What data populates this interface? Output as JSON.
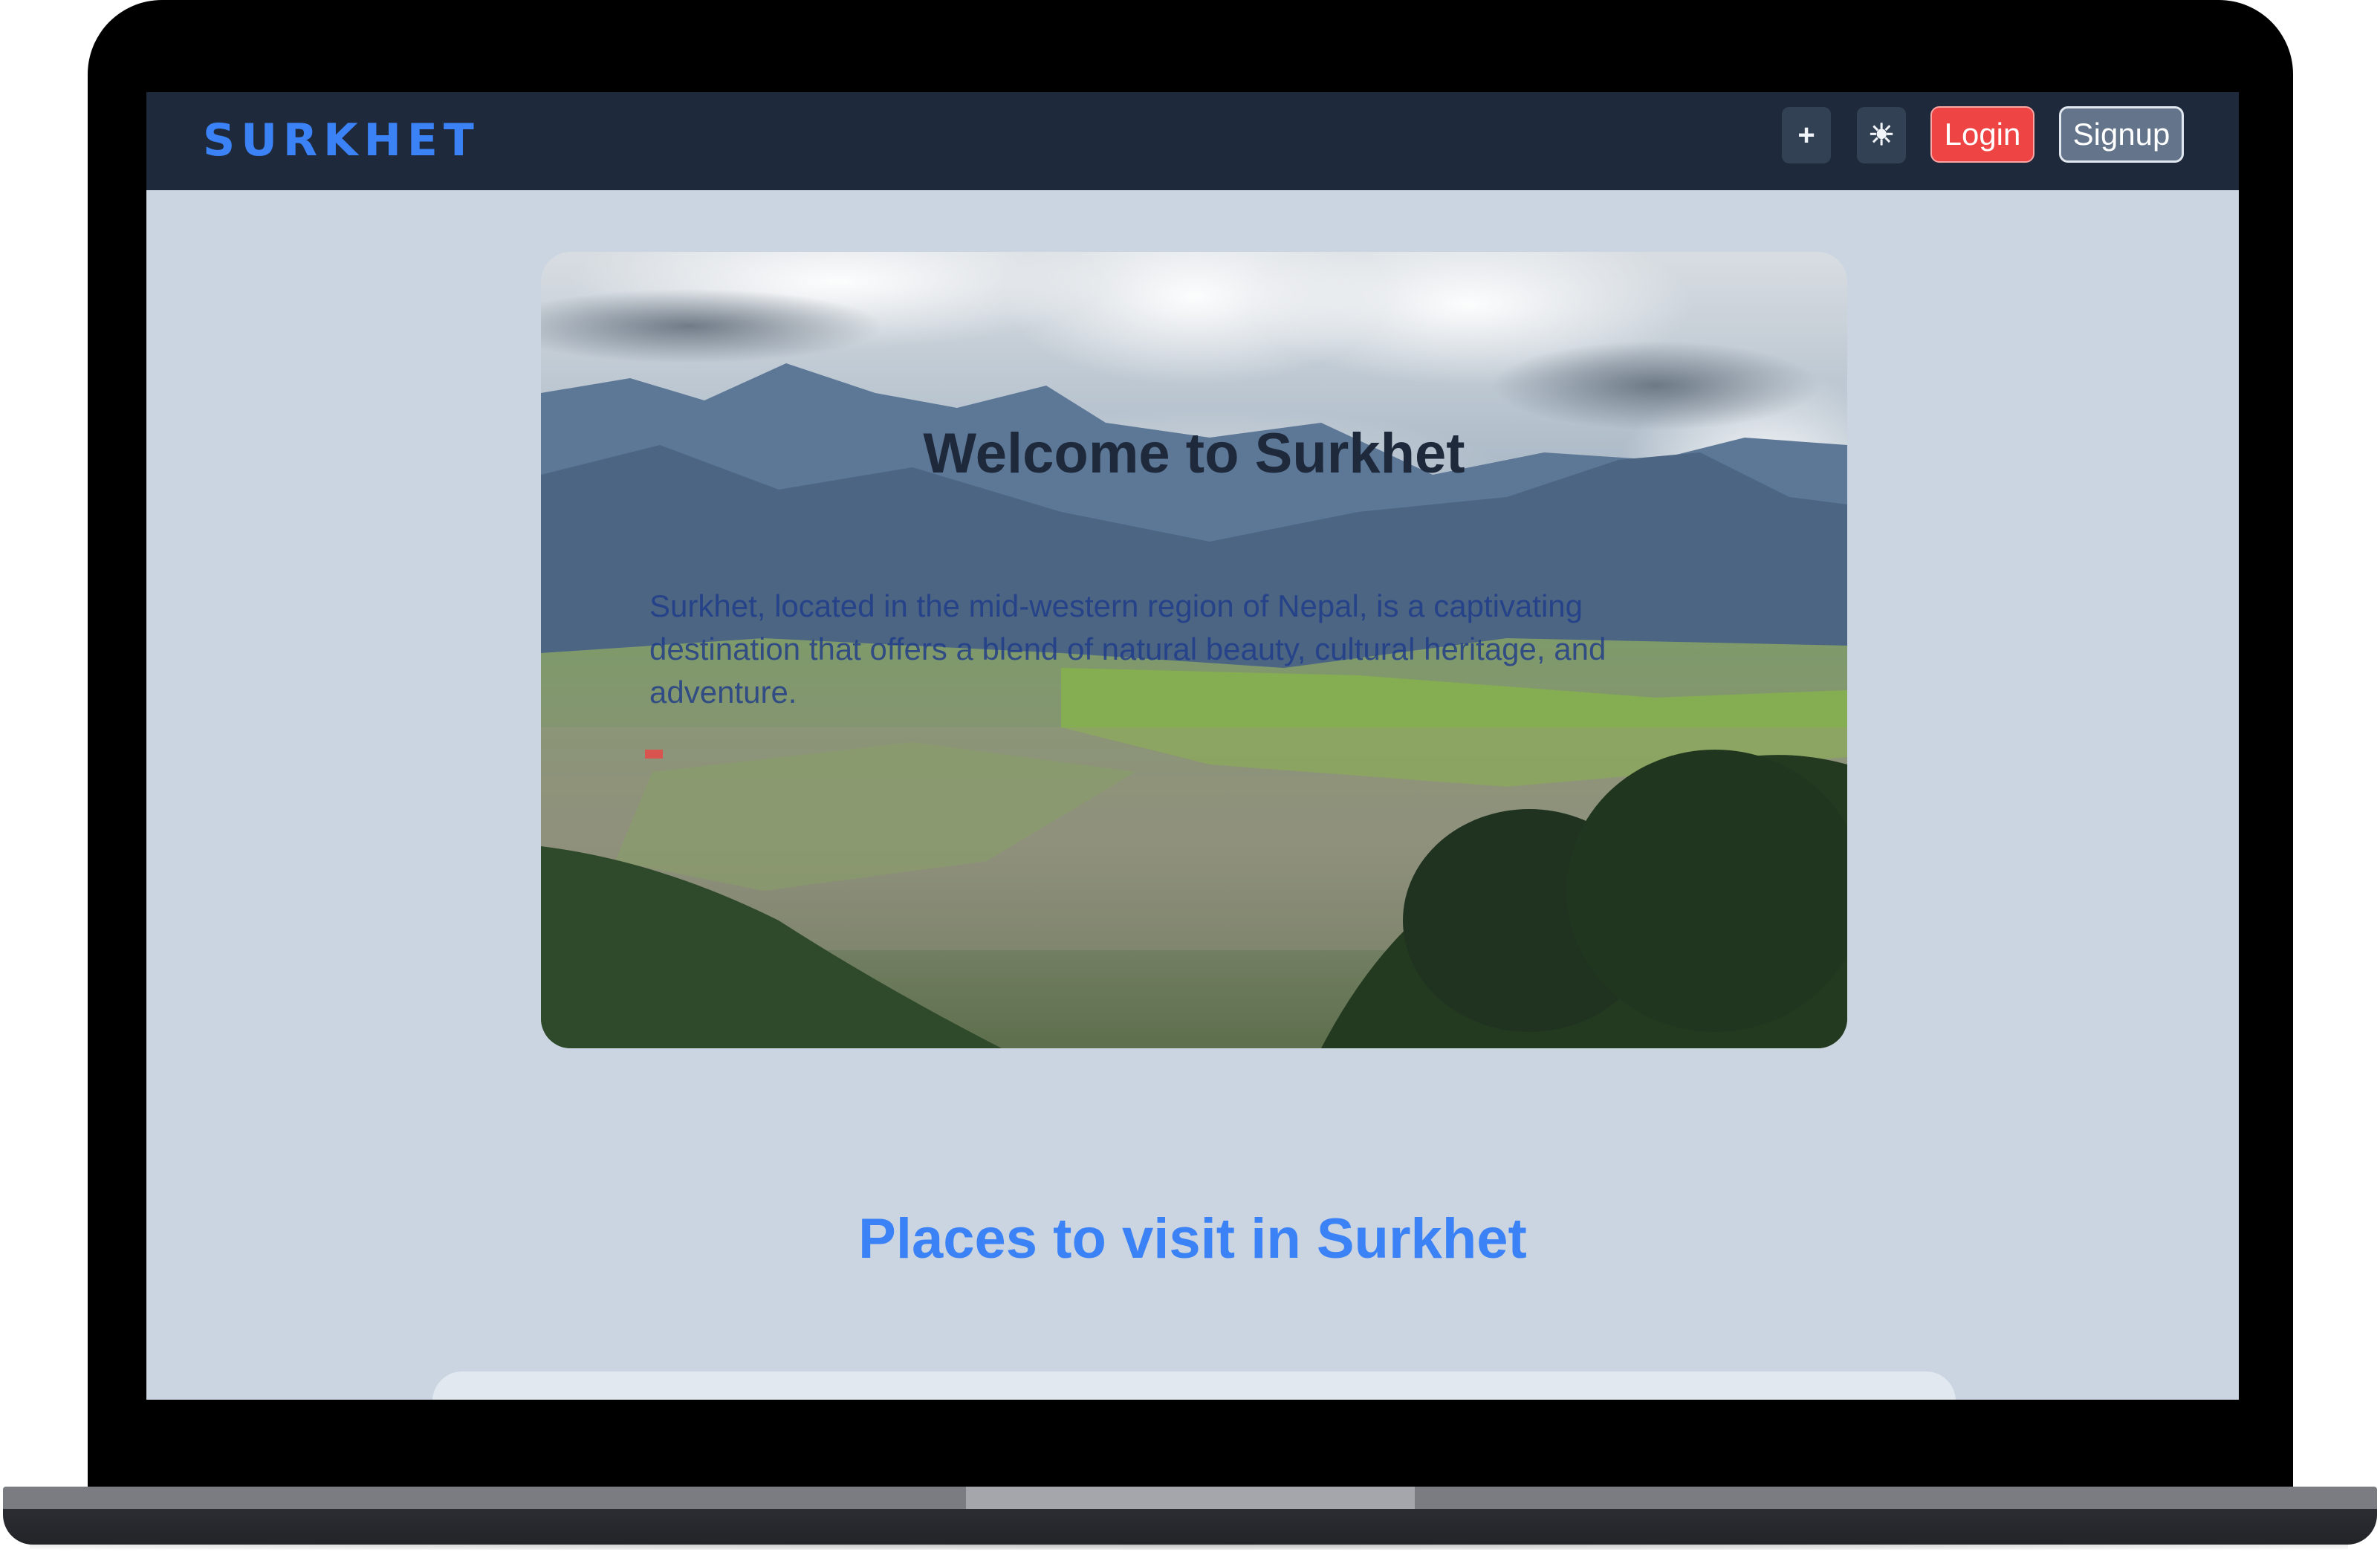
{
  "navbar": {
    "brand": "SURKHET",
    "add_icon": "plus-icon",
    "add_glyph": "+",
    "theme_icon": "sun-icon",
    "theme_glyph": "☀",
    "login_label": "Login",
    "signup_label": "Signup"
  },
  "hero": {
    "title": "Welcome to Surkhet",
    "description": "Surkhet, located in the mid-western region of Nepal, is a captivating destination that offers a blend of natural beauty, cultural heritage, and adventure."
  },
  "places": {
    "title": "Places to visit in Surkhet"
  },
  "colors": {
    "brand": "#3b82f6",
    "navbar_bg": "#1e293b",
    "page_bg": "#cbd5e1",
    "login_bg": "#ef4444",
    "signup_bg": "#64748b"
  }
}
